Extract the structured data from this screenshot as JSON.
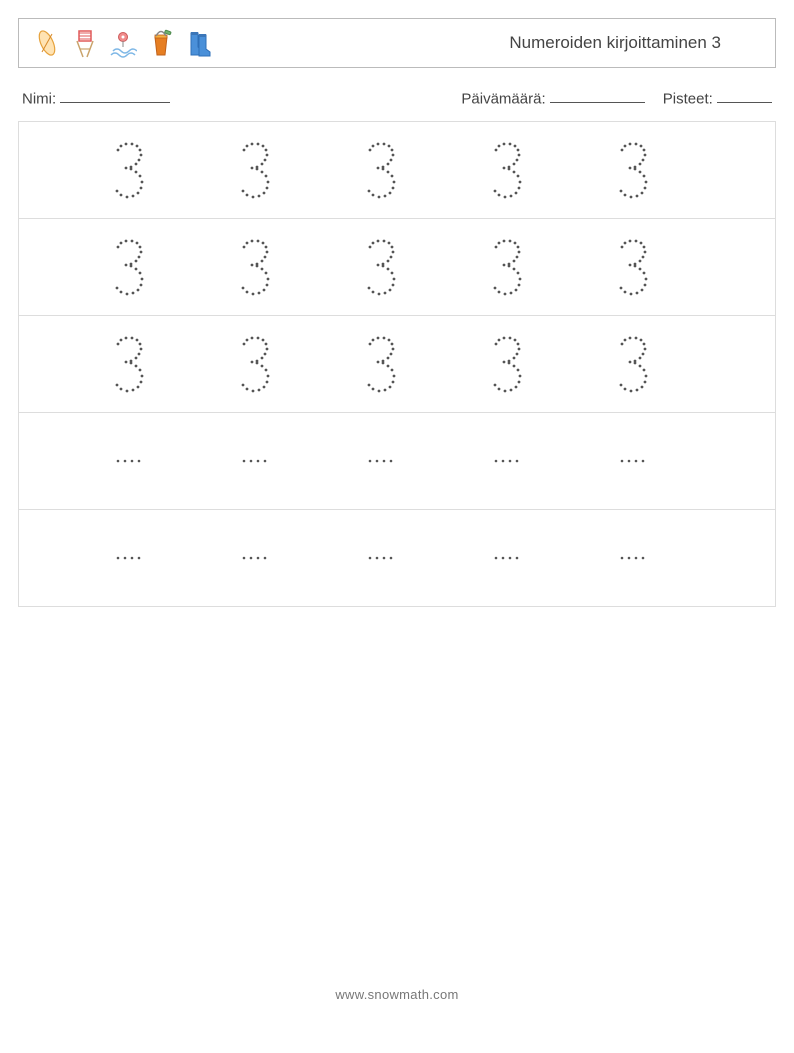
{
  "header": {
    "title": "Numeroiden kirjoittaminen 3",
    "icons": [
      "surfboard-icon",
      "chair-icon",
      "fishing-float-icon",
      "bucket-icon",
      "boots-icon"
    ]
  },
  "info": {
    "name_label": "Nimi:",
    "date_label": "Päivämäärä:",
    "score_label": "Pisteet:"
  },
  "worksheet": {
    "traced_numeral": "3",
    "rows": [
      {
        "type": "full",
        "count": 5
      },
      {
        "type": "full",
        "count": 5
      },
      {
        "type": "full",
        "count": 5
      },
      {
        "type": "dots",
        "count": 5
      },
      {
        "type": "dots",
        "count": 5
      }
    ]
  },
  "footer": {
    "url": "www.snowmath.com"
  }
}
